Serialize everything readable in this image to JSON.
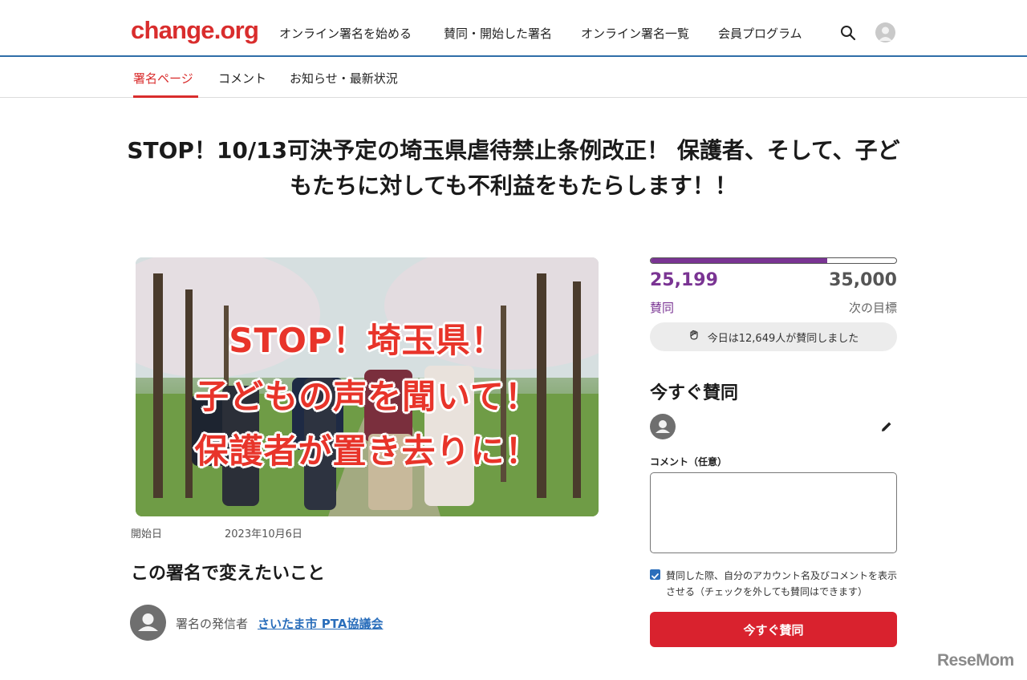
{
  "header": {
    "logo": "change.org",
    "nav": [
      {
        "label": "オンライン署名を始める"
      },
      {
        "label": "賛同・開始した署名"
      },
      {
        "label": "オンライン署名一覧"
      },
      {
        "label": "会員プログラム"
      }
    ]
  },
  "tabs": [
    {
      "label": "署名ページ",
      "active": true
    },
    {
      "label": "コメント",
      "active": false
    },
    {
      "label": "お知らせ・最新状況",
      "active": false
    }
  ],
  "petition": {
    "title": "STOP！10/13可決予定の埼玉県虐待禁止条例改正！ 保護者、そして、子どもたちに対しても不利益をもたらします！！",
    "image_text": [
      "STOP！埼玉県！",
      "子どもの声を聞いて！",
      "保護者が置き去りに！"
    ],
    "start_label": "開始日",
    "start_date": "2023年10月6日",
    "section_heading": "この署名で変えたいこと",
    "starter_label": "署名の発信者",
    "starter_name": "さいたま市 PTA協議会"
  },
  "progress": {
    "count": "25,199",
    "count_label": "賛同",
    "goal": "35,000",
    "goal_label": "次の目標",
    "fraction": 0.72,
    "today_text": "今日は12,649人が賛同しました"
  },
  "sign_form": {
    "heading": "今すぐ賛同",
    "comment_label": "コメント（任意）",
    "comment_value": "",
    "checkbox_checked": true,
    "checkbox_text": "賛同した際、自分のアカウント名及びコメントを表示させる（チェックを外しても賛同はできます）",
    "button_label": "今すぐ賛同"
  },
  "watermark": "ReseMom",
  "colors": {
    "brand_red": "#d92d2d",
    "progress_purple": "#7a3493",
    "link_blue": "#2a6ebb",
    "header_border": "#2f6ea8"
  }
}
